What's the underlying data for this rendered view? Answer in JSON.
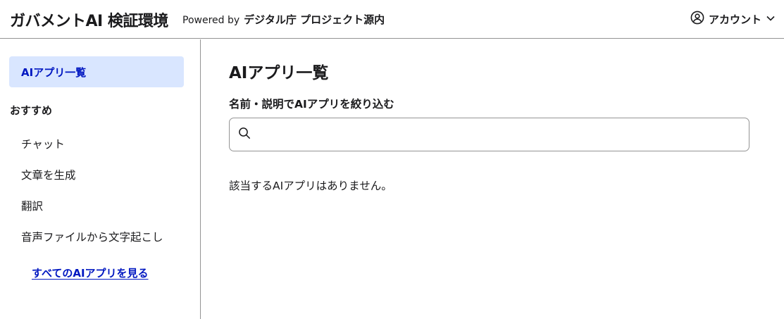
{
  "header": {
    "brand": "ガバメントAI 検証環境",
    "powered_prefix": "Powered by",
    "powered_org": "デジタル庁 プロジェクト源内",
    "account_label": "アカウント",
    "account_icon": "user-circle-icon",
    "account_chevron_icon": "chevron-down-icon"
  },
  "sidebar": {
    "active_item": "AIアプリ一覧",
    "section_title": "おすすめ",
    "items": [
      {
        "label": "チャット"
      },
      {
        "label": "文章を生成"
      },
      {
        "label": "翻訳"
      },
      {
        "label": "音声ファイルから文字起こし"
      }
    ],
    "all_apps_link": "すべてのAIアプリを見る"
  },
  "main": {
    "title": "AIアプリ一覧",
    "filter_label": "名前・説明でAIアプリを絞り込む",
    "search": {
      "value": "",
      "placeholder": "",
      "icon": "search-icon"
    },
    "empty_message": "該当するAIアプリはありません。"
  },
  "colors": {
    "accent": "#0017c1",
    "active_bg": "#d9e6ff",
    "border": "#949494",
    "text": "#1a1a1c"
  }
}
